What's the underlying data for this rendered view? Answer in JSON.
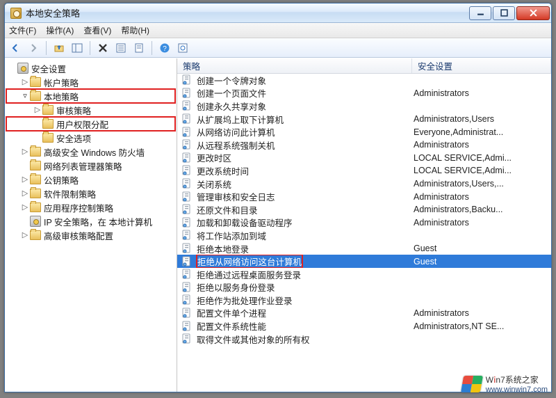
{
  "window": {
    "title": "本地安全策略"
  },
  "menu": {
    "file": "文件(F)",
    "action": "操作(A)",
    "view": "查看(V)",
    "help": "帮助(H)"
  },
  "tree": {
    "root": "安全设置",
    "items": [
      {
        "label": "帐户策略",
        "depth": 1,
        "expandable": true,
        "highlight": false
      },
      {
        "label": "本地策略",
        "depth": 1,
        "expandable": true,
        "open": true,
        "highlight": true
      },
      {
        "label": "审核策略",
        "depth": 2,
        "expandable": true,
        "highlight": false
      },
      {
        "label": "用户权限分配",
        "depth": 2,
        "expandable": false,
        "highlight": true
      },
      {
        "label": "安全选项",
        "depth": 2,
        "expandable": false,
        "highlight": false
      },
      {
        "label": "高级安全 Windows 防火墙",
        "depth": 1,
        "expandable": true,
        "highlight": false
      },
      {
        "label": "网络列表管理器策略",
        "depth": 1,
        "expandable": false,
        "highlight": false
      },
      {
        "label": "公钥策略",
        "depth": 1,
        "expandable": true,
        "highlight": false
      },
      {
        "label": "软件限制策略",
        "depth": 1,
        "expandable": true,
        "highlight": false
      },
      {
        "label": "应用程序控制策略",
        "depth": 1,
        "expandable": true,
        "highlight": false
      },
      {
        "label": "IP 安全策略，在 本地计算机",
        "depth": 1,
        "expandable": false,
        "icon": "shield",
        "highlight": false
      },
      {
        "label": "高级审核策略配置",
        "depth": 1,
        "expandable": true,
        "highlight": false
      }
    ]
  },
  "columns": {
    "policy": "策略",
    "setting": "安全设置"
  },
  "policies": [
    {
      "name": "创建一个令牌对象",
      "setting": ""
    },
    {
      "name": "创建一个页面文件",
      "setting": "Administrators"
    },
    {
      "name": "创建永久共享对象",
      "setting": ""
    },
    {
      "name": "从扩展坞上取下计算机",
      "setting": "Administrators,Users"
    },
    {
      "name": "从网络访问此计算机",
      "setting": "Everyone,Administrat..."
    },
    {
      "name": "从远程系统强制关机",
      "setting": "Administrators"
    },
    {
      "name": "更改时区",
      "setting": "LOCAL SERVICE,Admi..."
    },
    {
      "name": "更改系统时间",
      "setting": "LOCAL SERVICE,Admi..."
    },
    {
      "name": "关闭系统",
      "setting": "Administrators,Users,..."
    },
    {
      "name": "管理审核和安全日志",
      "setting": "Administrators"
    },
    {
      "name": "还原文件和目录",
      "setting": "Administrators,Backu..."
    },
    {
      "name": "加载和卸载设备驱动程序",
      "setting": "Administrators"
    },
    {
      "name": "将工作站添加到域",
      "setting": ""
    },
    {
      "name": "拒绝本地登录",
      "setting": "Guest"
    },
    {
      "name": "拒绝从网络访问这台计算机",
      "setting": "Guest",
      "selected": true,
      "highlight": true
    },
    {
      "name": "拒绝通过远程桌面服务登录",
      "setting": ""
    },
    {
      "name": "拒绝以服务身份登录",
      "setting": ""
    },
    {
      "name": "拒绝作为批处理作业登录",
      "setting": ""
    },
    {
      "name": "配置文件单个进程",
      "setting": "Administrators"
    },
    {
      "name": "配置文件系统性能",
      "setting": "Administrators,NT SE..."
    },
    {
      "name": "取得文件或其他对象的所有权",
      "setting": ""
    }
  ],
  "watermark": {
    "brand_html": "W<strong>i</strong>n7系统之家",
    "brand_plain": "Win7系统之家",
    "url": "www.winwin7.com"
  }
}
